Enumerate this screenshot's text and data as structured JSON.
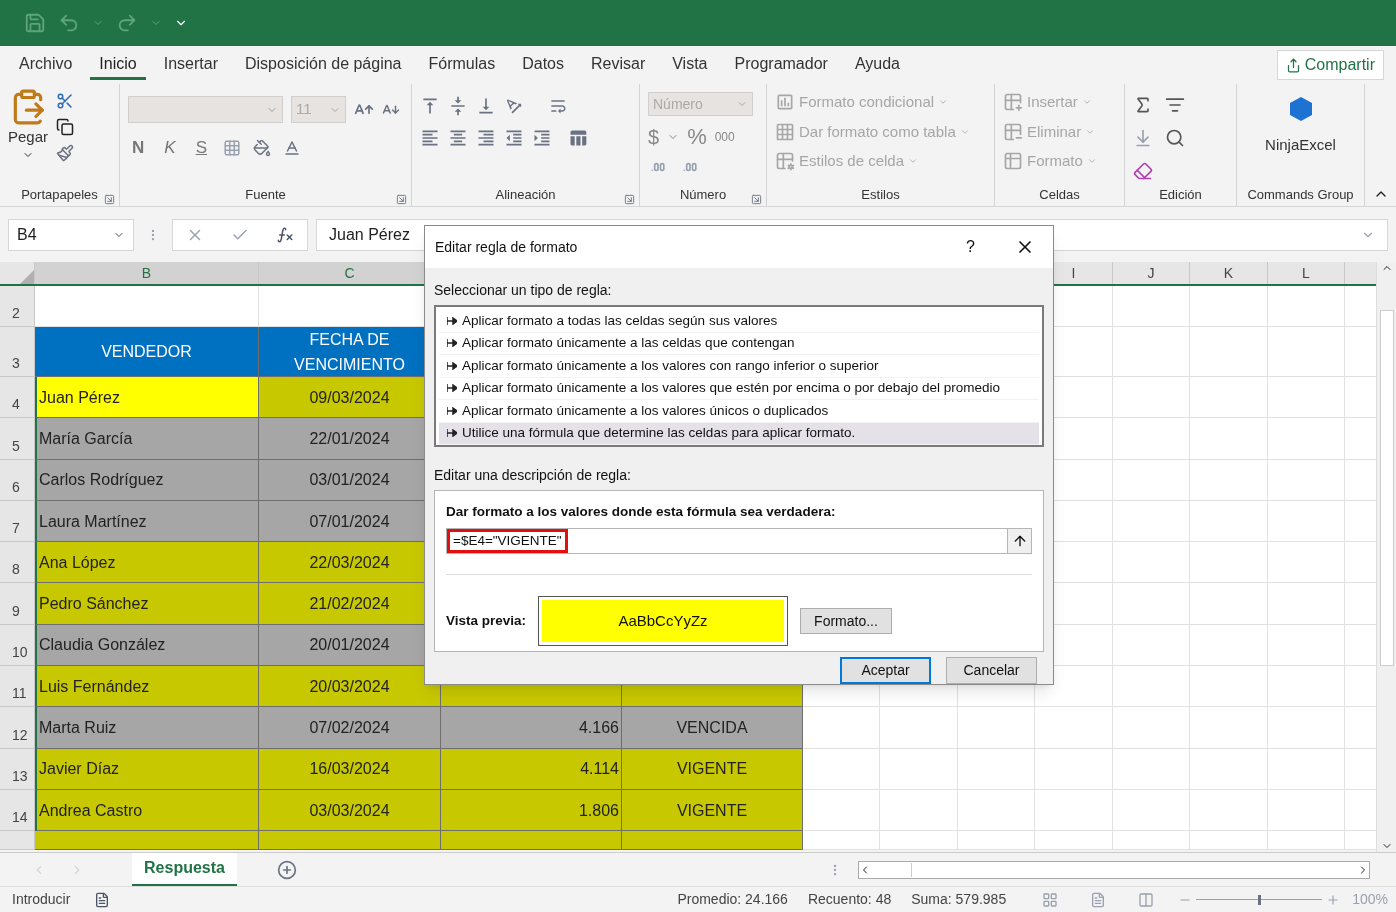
{
  "tabs": [
    {
      "label": "Archivo",
      "selected": false
    },
    {
      "label": "Inicio",
      "selected": true
    },
    {
      "label": "Insertar",
      "selected": false
    },
    {
      "label": "Disposición de página",
      "selected": false
    },
    {
      "label": "Fórmulas",
      "selected": false
    },
    {
      "label": "Datos",
      "selected": false
    },
    {
      "label": "Revisar",
      "selected": false
    },
    {
      "label": "Vista",
      "selected": false
    },
    {
      "label": "Programador",
      "selected": false
    },
    {
      "label": "Ayuda",
      "selected": false
    }
  ],
  "share_button": "Compartir",
  "ribbon": {
    "paste": "Pegar",
    "font_size": "11",
    "bold": "N",
    "italic": "K",
    "underline": "S",
    "number_format": "Número",
    "currency": "$",
    "percent": "%",
    "thousands": "000",
    "styles": [
      {
        "label": "Formato condicional",
        "disabled": true
      },
      {
        "label": "Dar formato como tabla",
        "disabled": true
      },
      {
        "label": "Estilos de celda",
        "disabled": true
      }
    ],
    "cells": [
      {
        "label": "Insertar",
        "disabled": true
      },
      {
        "label": "Eliminar",
        "disabled": true
      },
      {
        "label": "Formato",
        "disabled": true
      }
    ],
    "addin": "NinjaExcel",
    "groups": [
      "Portapapeles",
      "Fuente",
      "Alineación",
      "Número",
      "Estilos",
      "Celdas",
      "Edición",
      "Commands Group"
    ]
  },
  "formula_bar": {
    "name_box": "B4",
    "value": "Juan Pérez"
  },
  "column_headers": [
    "B",
    "C",
    "I",
    "J",
    "K",
    "L"
  ],
  "rows": [
    {
      "number": "2",
      "cells": []
    },
    {
      "number": "3",
      "kind": "header",
      "cells": [
        {
          "text": "VENDEDOR",
          "color": "#0070c0"
        },
        {
          "text": "FECHA DE VENCIMIENTO",
          "color": "#0070c0"
        }
      ]
    },
    {
      "number": "4",
      "cells": [
        {
          "text": "Juan Pérez",
          "color": "#ffff00"
        },
        {
          "text": "09/03/2024",
          "color": "#c8c800"
        }
      ]
    },
    {
      "number": "5",
      "cells": [
        {
          "text": "María García",
          "color": "#a6a6a6"
        },
        {
          "text": "22/01/2024",
          "color": "#a6a6a6"
        }
      ]
    },
    {
      "number": "6",
      "cells": [
        {
          "text": "Carlos Rodríguez",
          "color": "#a6a6a6"
        },
        {
          "text": "03/01/2024",
          "color": "#a6a6a6"
        }
      ]
    },
    {
      "number": "7",
      "cells": [
        {
          "text": "Laura Martínez",
          "color": "#a6a6a6"
        },
        {
          "text": "07/01/2024",
          "color": "#a6a6a6"
        }
      ]
    },
    {
      "number": "8",
      "cells": [
        {
          "text": "Ana López",
          "color": "#c8c800"
        },
        {
          "text": "22/03/2024",
          "color": "#c8c800"
        }
      ]
    },
    {
      "number": "9",
      "cells": [
        {
          "text": "Pedro Sánchez",
          "color": "#c8c800"
        },
        {
          "text": "21/02/2024",
          "color": "#c8c800"
        }
      ]
    },
    {
      "number": "10",
      "cells": [
        {
          "text": "Claudia González",
          "color": "#a6a6a6"
        },
        {
          "text": "20/01/2024",
          "color": "#a6a6a6"
        }
      ]
    },
    {
      "number": "11",
      "cells": [
        {
          "text": "Luis Fernández",
          "color": "#c8c800"
        },
        {
          "text": "20/03/2024",
          "color": "#c8c800"
        },
        {
          "color": "#c8c800"
        },
        {
          "color": "#c8c800"
        }
      ]
    },
    {
      "number": "12",
      "cells": [
        {
          "text": "Marta Ruiz",
          "color": "#a6a6a6"
        },
        {
          "text": "07/02/2024",
          "color": "#a6a6a6"
        },
        {
          "text": "4.166",
          "color": "#a6a6a6"
        },
        {
          "text": "VENCIDA",
          "color": "#a6a6a6"
        }
      ]
    },
    {
      "number": "13",
      "cells": [
        {
          "text": "Javier Díaz",
          "color": "#c8c800"
        },
        {
          "text": "16/03/2024",
          "color": "#c8c800"
        },
        {
          "text": "4.114",
          "color": "#c8c800"
        },
        {
          "text": "VIGENTE",
          "color": "#c8c800"
        }
      ]
    },
    {
      "number": "14",
      "cells": [
        {
          "text": "Andrea Castro",
          "color": "#c8c800"
        },
        {
          "text": "03/03/2024",
          "color": "#c8c800"
        },
        {
          "text": "1.806",
          "color": "#c8c800"
        },
        {
          "text": "VIGENTE",
          "color": "#c8c800"
        }
      ]
    },
    {
      "kind": "partial",
      "cells": [
        {
          "color": "#c8c800"
        },
        {
          "color": "#c8c800"
        },
        {
          "color": "#c8c800"
        },
        {
          "color": "#c8c800"
        }
      ]
    }
  ],
  "dialog": {
    "title": "Editar regla de formato",
    "help": "?",
    "rule_type_label": "Seleccionar un tipo de regla:",
    "rule_types": [
      {
        "label": "Aplicar formato a todas las celdas según sus valores",
        "selected": false
      },
      {
        "label": "Aplicar formato únicamente a las celdas que contengan",
        "selected": false
      },
      {
        "label": "Aplicar formato únicamente a los valores con rango inferior o superior",
        "selected": false
      },
      {
        "label": "Aplicar formato únicamente a los valores que estén por encima o por debajo del promedio",
        "selected": false
      },
      {
        "label": "Aplicar formato únicamente a los valores únicos o duplicados",
        "selected": false
      },
      {
        "label": "Utilice una fórmula que determine las celdas para aplicar formato.",
        "selected": true
      }
    ],
    "description_label": "Editar una descripción de regla:",
    "formula_label": "Dar formato a los valores donde esta fórmula sea verdadera:",
    "formula": "=$E4=\"VIGENTE\"",
    "formula_highlighted": true,
    "preview_label": "Vista previa:",
    "preview_text": "AaBbCcYyZz",
    "format_button": "Formato...",
    "buttons": [
      {
        "label": "Aceptar",
        "default": true
      },
      {
        "label": "Cancelar",
        "default": false
      }
    ]
  },
  "sheet_tabs": [
    {
      "label": "Respuesta",
      "selected": true
    }
  ],
  "status_bar": {
    "mode": "Introducir",
    "stats": [
      "Promedio: 24.166",
      "Recuento: 48",
      "Suma: 579.985"
    ],
    "zoom": {
      "reading": "100%",
      "level": 0.5
    }
  }
}
